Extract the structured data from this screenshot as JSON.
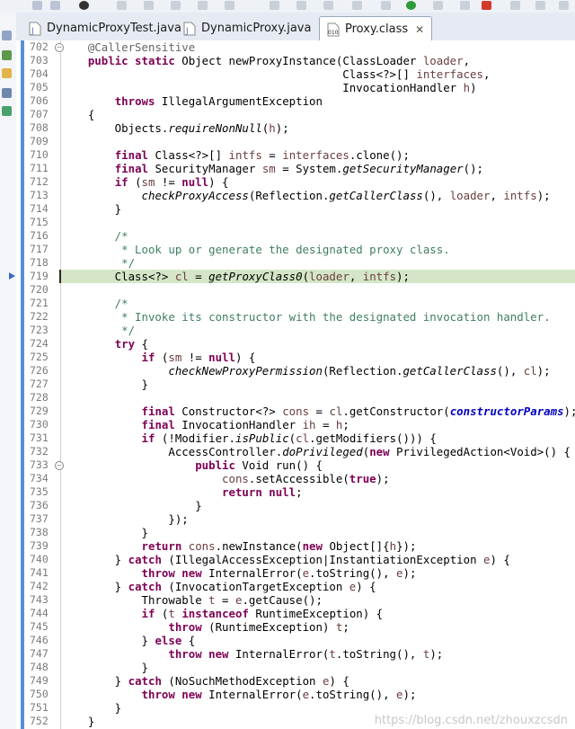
{
  "tabs": [
    {
      "label": "DynamicProxyTest.java",
      "icon": "java-file-icon",
      "active": false
    },
    {
      "label": "DynamicProxy.java",
      "icon": "java-file-icon",
      "active": false
    },
    {
      "label": "Proxy.class",
      "icon": "class-file-icon",
      "active": true,
      "close": "✕"
    }
  ],
  "editor": {
    "current_line": "719",
    "lines": [
      {
        "num": "702",
        "fold": "⊖",
        "tokens": [
          {
            "t": "    "
          },
          {
            "t": "@CallerSensitive",
            "c": "an"
          }
        ]
      },
      {
        "num": "703",
        "tokens": [
          {
            "t": "    "
          },
          {
            "t": "public static",
            "c": "kw"
          },
          {
            "t": " Object newProxyInstance(ClassLoader "
          },
          {
            "t": "loader",
            "c": "var"
          },
          {
            "t": ","
          }
        ]
      },
      {
        "num": "704",
        "tokens": [
          {
            "t": "                                          Class<?>[] "
          },
          {
            "t": "interfaces",
            "c": "var"
          },
          {
            "t": ","
          }
        ]
      },
      {
        "num": "705",
        "tokens": [
          {
            "t": "                                          InvocationHandler "
          },
          {
            "t": "h",
            "c": "var"
          },
          {
            "t": ")"
          }
        ]
      },
      {
        "num": "706",
        "tokens": [
          {
            "t": "        "
          },
          {
            "t": "throws",
            "c": "kw"
          },
          {
            "t": " IllegalArgumentException"
          }
        ]
      },
      {
        "num": "707",
        "tokens": [
          {
            "t": "    {"
          }
        ]
      },
      {
        "num": "708",
        "tokens": [
          {
            "t": "        Objects."
          },
          {
            "t": "requireNonNull",
            "c": "it"
          },
          {
            "t": "("
          },
          {
            "t": "h",
            "c": "var"
          },
          {
            "t": ");"
          }
        ]
      },
      {
        "num": "709",
        "tokens": []
      },
      {
        "num": "710",
        "tokens": [
          {
            "t": "        "
          },
          {
            "t": "final",
            "c": "kw"
          },
          {
            "t": " Class<?>[] "
          },
          {
            "t": "intfs",
            "c": "var"
          },
          {
            "t": " = "
          },
          {
            "t": "interfaces",
            "c": "var"
          },
          {
            "t": ".clone();"
          }
        ]
      },
      {
        "num": "711",
        "tokens": [
          {
            "t": "        "
          },
          {
            "t": "final",
            "c": "kw"
          },
          {
            "t": " SecurityManager "
          },
          {
            "t": "sm",
            "c": "var"
          },
          {
            "t": " = System."
          },
          {
            "t": "getSecurityManager",
            "c": "it"
          },
          {
            "t": "();"
          }
        ]
      },
      {
        "num": "712",
        "tokens": [
          {
            "t": "        "
          },
          {
            "t": "if",
            "c": "kw"
          },
          {
            "t": " ("
          },
          {
            "t": "sm",
            "c": "var"
          },
          {
            "t": " != "
          },
          {
            "t": "null",
            "c": "kw"
          },
          {
            "t": ") {"
          }
        ]
      },
      {
        "num": "713",
        "tokens": [
          {
            "t": "            "
          },
          {
            "t": "checkProxyAccess",
            "c": "it"
          },
          {
            "t": "(Reflection."
          },
          {
            "t": "getCallerClass",
            "c": "it"
          },
          {
            "t": "(), "
          },
          {
            "t": "loader",
            "c": "var"
          },
          {
            "t": ", "
          },
          {
            "t": "intfs",
            "c": "var"
          },
          {
            "t": ");"
          }
        ]
      },
      {
        "num": "714",
        "tokens": [
          {
            "t": "        }"
          }
        ]
      },
      {
        "num": "715",
        "tokens": []
      },
      {
        "num": "716",
        "tokens": [
          {
            "t": "        /*",
            "c": "cm"
          }
        ]
      },
      {
        "num": "717",
        "tokens": [
          {
            "t": "         * Look up or generate the designated proxy class.",
            "c": "cm"
          }
        ]
      },
      {
        "num": "718",
        "tokens": [
          {
            "t": "         */",
            "c": "cm"
          }
        ]
      },
      {
        "num": "719",
        "highlight": true,
        "tokens": [
          {
            "t": "        Class<?> "
          },
          {
            "t": "cl",
            "c": "var"
          },
          {
            "t": " = "
          },
          {
            "t": "getProxyClass0",
            "c": "it"
          },
          {
            "t": "("
          },
          {
            "t": "loader",
            "c": "var"
          },
          {
            "t": ", "
          },
          {
            "t": "intfs",
            "c": "var"
          },
          {
            "t": ");"
          }
        ]
      },
      {
        "num": "720",
        "tokens": []
      },
      {
        "num": "721",
        "tokens": [
          {
            "t": "        /*",
            "c": "cm"
          }
        ]
      },
      {
        "num": "722",
        "tokens": [
          {
            "t": "         * Invoke its constructor with the designated invocation handler.",
            "c": "cm"
          }
        ]
      },
      {
        "num": "723",
        "tokens": [
          {
            "t": "         */",
            "c": "cm"
          }
        ]
      },
      {
        "num": "724",
        "tokens": [
          {
            "t": "        "
          },
          {
            "t": "try",
            "c": "kw"
          },
          {
            "t": " {"
          }
        ]
      },
      {
        "num": "725",
        "tokens": [
          {
            "t": "            "
          },
          {
            "t": "if",
            "c": "kw"
          },
          {
            "t": " ("
          },
          {
            "t": "sm",
            "c": "var"
          },
          {
            "t": " != "
          },
          {
            "t": "null",
            "c": "kw"
          },
          {
            "t": ") {"
          }
        ]
      },
      {
        "num": "726",
        "tokens": [
          {
            "t": "                "
          },
          {
            "t": "checkNewProxyPermission",
            "c": "it"
          },
          {
            "t": "(Reflection."
          },
          {
            "t": "getCallerClass",
            "c": "it"
          },
          {
            "t": "(), "
          },
          {
            "t": "cl",
            "c": "var"
          },
          {
            "t": ");"
          }
        ]
      },
      {
        "num": "727",
        "tokens": [
          {
            "t": "            }"
          }
        ]
      },
      {
        "num": "728",
        "tokens": []
      },
      {
        "num": "729",
        "tokens": [
          {
            "t": "            "
          },
          {
            "t": "final",
            "c": "kw"
          },
          {
            "t": " Constructor<?> "
          },
          {
            "t": "cons",
            "c": "var"
          },
          {
            "t": " = "
          },
          {
            "t": "cl",
            "c": "var"
          },
          {
            "t": ".getConstructor("
          },
          {
            "t": "constructorParams",
            "c": "fld"
          },
          {
            "t": ");"
          }
        ]
      },
      {
        "num": "730",
        "tokens": [
          {
            "t": "            "
          },
          {
            "t": "final",
            "c": "kw"
          },
          {
            "t": " InvocationHandler "
          },
          {
            "t": "ih",
            "c": "var"
          },
          {
            "t": " = "
          },
          {
            "t": "h",
            "c": "var"
          },
          {
            "t": ";"
          }
        ]
      },
      {
        "num": "731",
        "tokens": [
          {
            "t": "            "
          },
          {
            "t": "if",
            "c": "kw"
          },
          {
            "t": " (!Modifier."
          },
          {
            "t": "isPublic",
            "c": "it"
          },
          {
            "t": "("
          },
          {
            "t": "cl",
            "c": "var"
          },
          {
            "t": ".getModifiers())) {"
          }
        ]
      },
      {
        "num": "732",
        "tokens": [
          {
            "t": "                AccessController."
          },
          {
            "t": "doPrivileged",
            "c": "it"
          },
          {
            "t": "("
          },
          {
            "t": "new",
            "c": "kw"
          },
          {
            "t": " PrivilegedAction<Void>() {"
          }
        ]
      },
      {
        "num": "733",
        "fold": "⊖",
        "tokens": [
          {
            "t": "                    "
          },
          {
            "t": "public",
            "c": "kw"
          },
          {
            "t": " Void run() {"
          }
        ]
      },
      {
        "num": "734",
        "tokens": [
          {
            "t": "                        "
          },
          {
            "t": "cons",
            "c": "var"
          },
          {
            "t": ".setAccessible("
          },
          {
            "t": "true",
            "c": "kw"
          },
          {
            "t": ");"
          }
        ]
      },
      {
        "num": "735",
        "tokens": [
          {
            "t": "                        "
          },
          {
            "t": "return null",
            "c": "kw"
          },
          {
            "t": ";"
          }
        ]
      },
      {
        "num": "736",
        "tokens": [
          {
            "t": "                    }"
          }
        ]
      },
      {
        "num": "737",
        "tokens": [
          {
            "t": "                });"
          }
        ]
      },
      {
        "num": "738",
        "tokens": [
          {
            "t": "            }"
          }
        ]
      },
      {
        "num": "739",
        "tokens": [
          {
            "t": "            "
          },
          {
            "t": "return",
            "c": "kw"
          },
          {
            "t": " "
          },
          {
            "t": "cons",
            "c": "var"
          },
          {
            "t": ".newInstance("
          },
          {
            "t": "new",
            "c": "kw"
          },
          {
            "t": " Object[]{"
          },
          {
            "t": "h",
            "c": "var"
          },
          {
            "t": "});"
          }
        ]
      },
      {
        "num": "740",
        "tokens": [
          {
            "t": "        } "
          },
          {
            "t": "catch",
            "c": "kw"
          },
          {
            "t": " (IllegalAccessException|InstantiationException "
          },
          {
            "t": "e",
            "c": "var"
          },
          {
            "t": ") {"
          }
        ]
      },
      {
        "num": "741",
        "tokens": [
          {
            "t": "            "
          },
          {
            "t": "throw new",
            "c": "kw"
          },
          {
            "t": " InternalError("
          },
          {
            "t": "e",
            "c": "var"
          },
          {
            "t": ".toString(), "
          },
          {
            "t": "e",
            "c": "var"
          },
          {
            "t": ");"
          }
        ]
      },
      {
        "num": "742",
        "tokens": [
          {
            "t": "        } "
          },
          {
            "t": "catch",
            "c": "kw"
          },
          {
            "t": " (InvocationTargetException "
          },
          {
            "t": "e",
            "c": "var"
          },
          {
            "t": ") {"
          }
        ]
      },
      {
        "num": "743",
        "tokens": [
          {
            "t": "            Throwable "
          },
          {
            "t": "t",
            "c": "var"
          },
          {
            "t": " = "
          },
          {
            "t": "e",
            "c": "var"
          },
          {
            "t": ".getCause();"
          }
        ]
      },
      {
        "num": "744",
        "tokens": [
          {
            "t": "            "
          },
          {
            "t": "if",
            "c": "kw"
          },
          {
            "t": " ("
          },
          {
            "t": "t",
            "c": "var"
          },
          {
            "t": " "
          },
          {
            "t": "instanceof",
            "c": "kw"
          },
          {
            "t": " RuntimeException) {"
          }
        ]
      },
      {
        "num": "745",
        "tokens": [
          {
            "t": "                "
          },
          {
            "t": "throw",
            "c": "kw"
          },
          {
            "t": " (RuntimeException) "
          },
          {
            "t": "t",
            "c": "var"
          },
          {
            "t": ";"
          }
        ]
      },
      {
        "num": "746",
        "tokens": [
          {
            "t": "            } "
          },
          {
            "t": "else",
            "c": "kw"
          },
          {
            "t": " {"
          }
        ]
      },
      {
        "num": "747",
        "tokens": [
          {
            "t": "                "
          },
          {
            "t": "throw new",
            "c": "kw"
          },
          {
            "t": " InternalError("
          },
          {
            "t": "t",
            "c": "var"
          },
          {
            "t": ".toString(), "
          },
          {
            "t": "t",
            "c": "var"
          },
          {
            "t": ");"
          }
        ]
      },
      {
        "num": "748",
        "tokens": [
          {
            "t": "            }"
          }
        ]
      },
      {
        "num": "749",
        "tokens": [
          {
            "t": "        } "
          },
          {
            "t": "catch",
            "c": "kw"
          },
          {
            "t": " (NoSuchMethodException "
          },
          {
            "t": "e",
            "c": "var"
          },
          {
            "t": ") {"
          }
        ]
      },
      {
        "num": "750",
        "tokens": [
          {
            "t": "            "
          },
          {
            "t": "throw new",
            "c": "kw"
          },
          {
            "t": " InternalError("
          },
          {
            "t": "e",
            "c": "var"
          },
          {
            "t": ".toString(), "
          },
          {
            "t": "e",
            "c": "var"
          },
          {
            "t": ");"
          }
        ]
      },
      {
        "num": "751",
        "tokens": [
          {
            "t": "        }"
          }
        ]
      },
      {
        "num": "752",
        "tokens": [
          {
            "t": "    }"
          }
        ]
      }
    ]
  },
  "watermark": "https://blog.csdn.net/zhouxzcsdn",
  "colors": {
    "keyword": "#7f0055",
    "comment": "#3f7f5f",
    "variable": "#6a3e3e",
    "field": "#0000c0",
    "highlight": "#d4e6c7"
  }
}
